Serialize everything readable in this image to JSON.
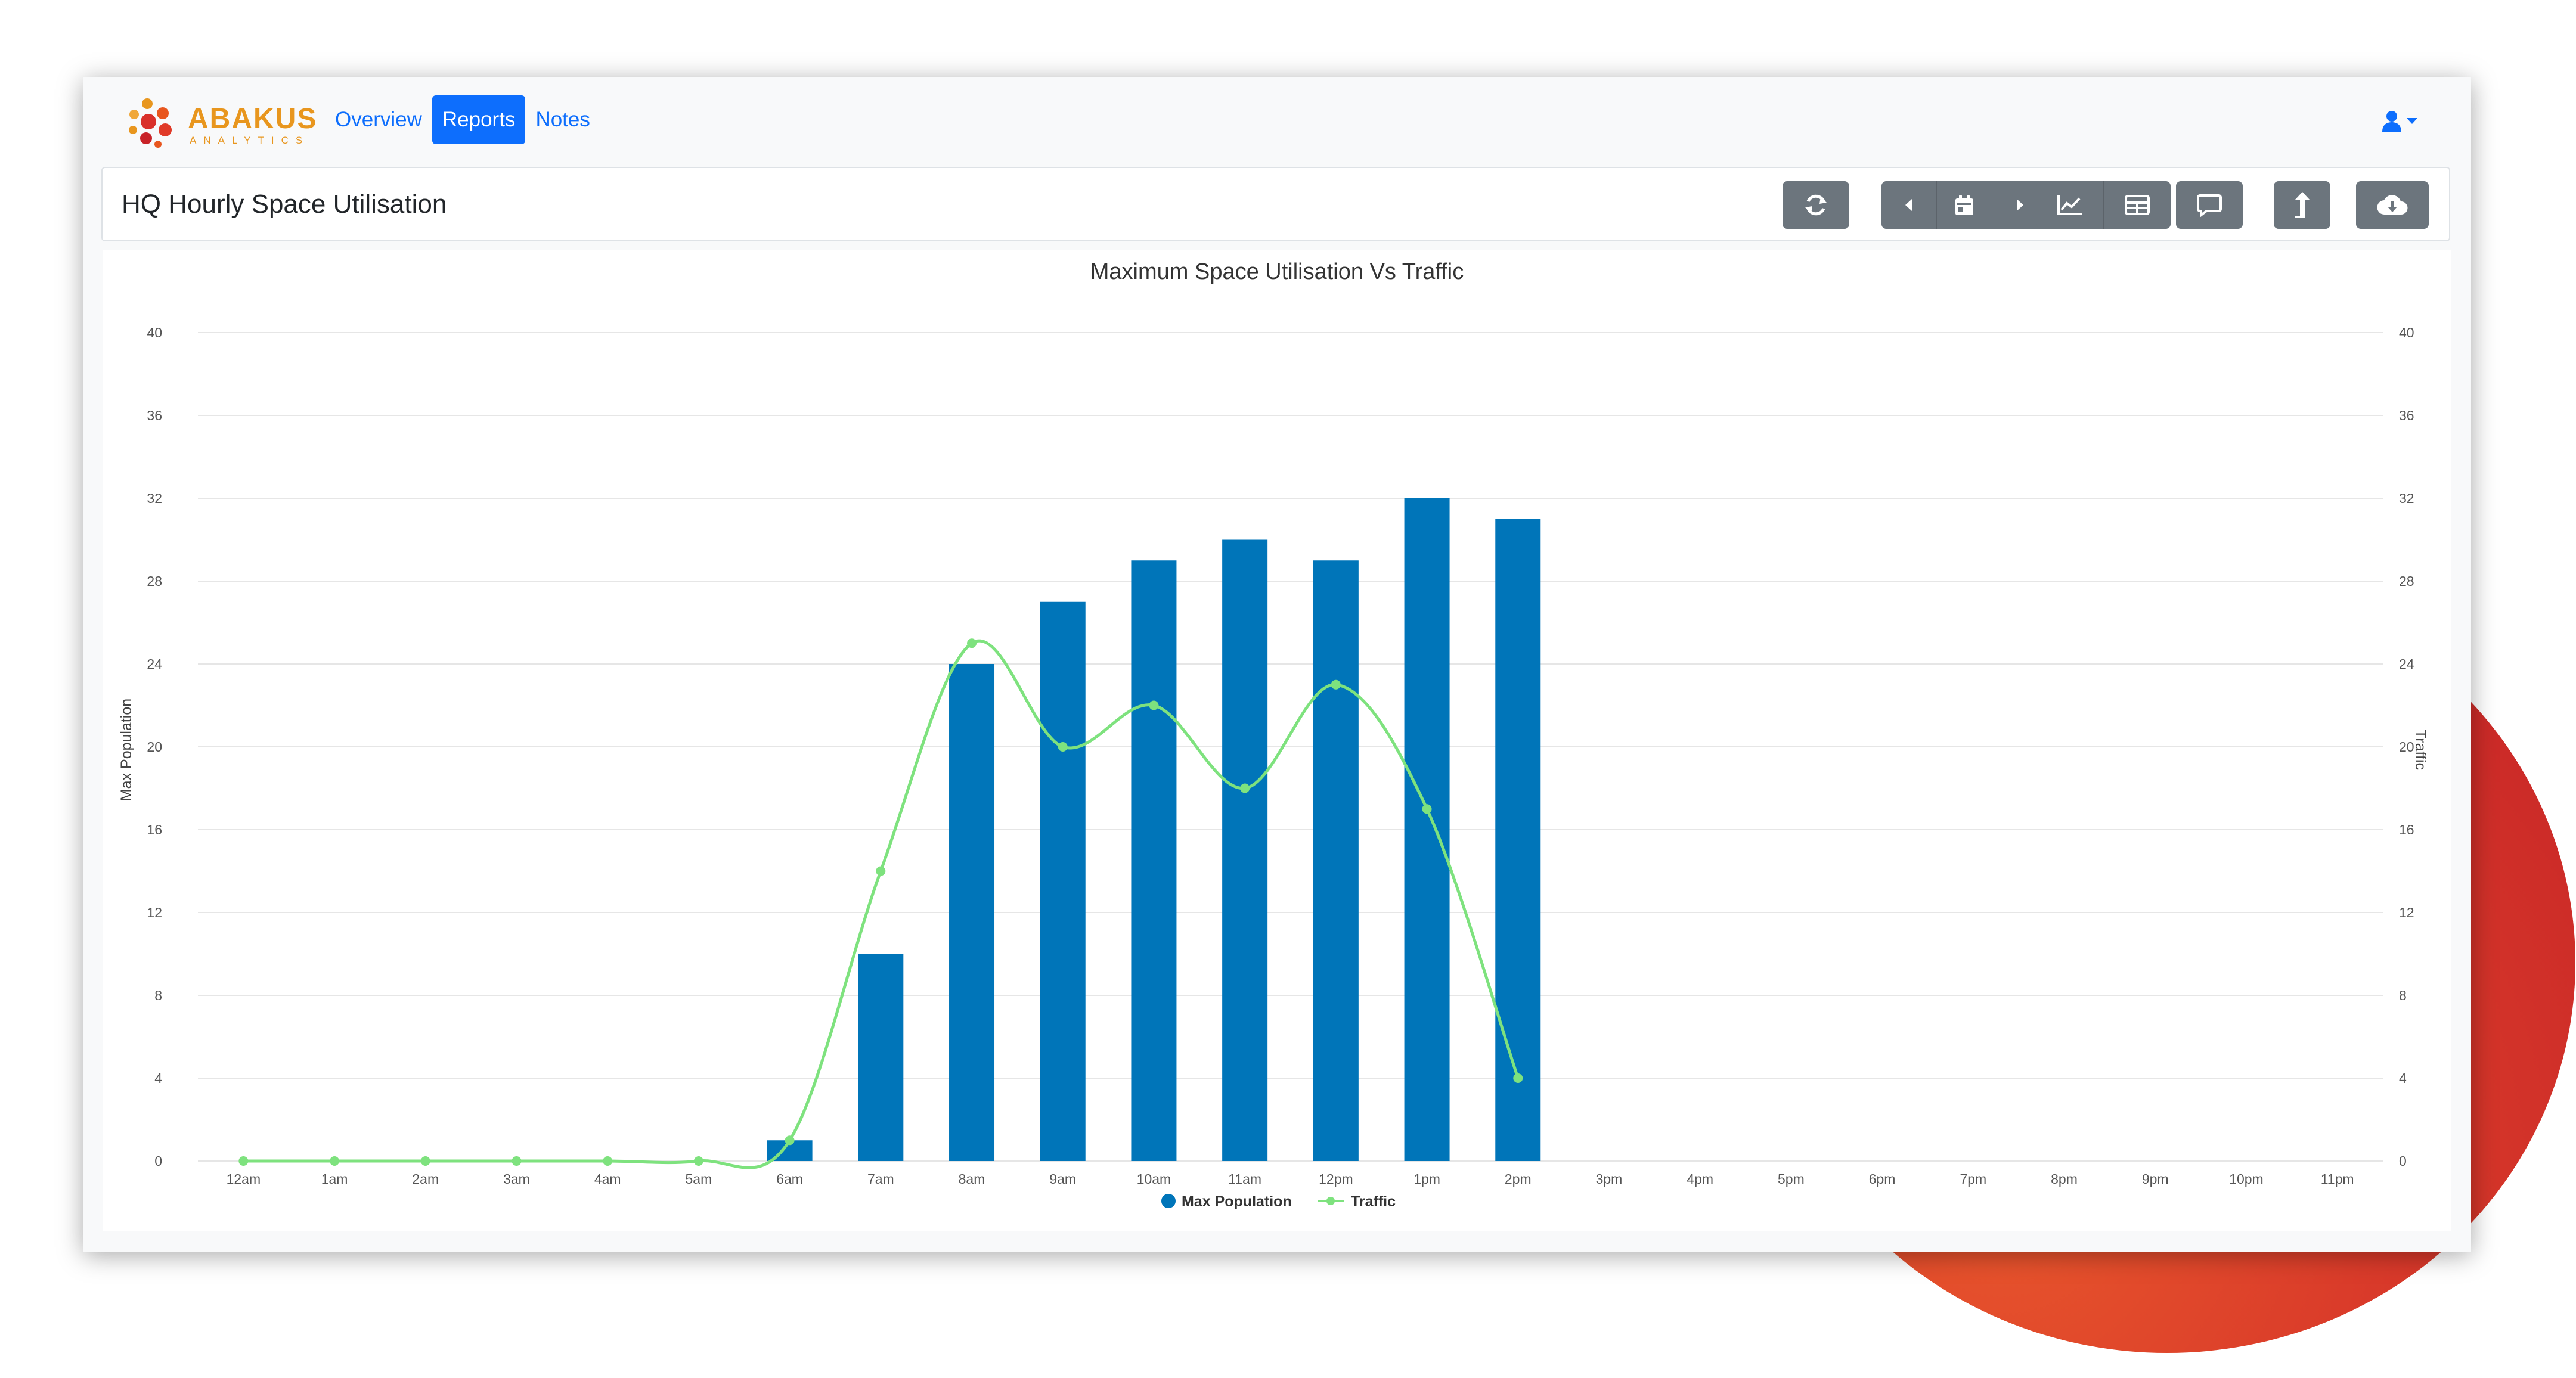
{
  "app": {
    "logo_text": "ABAKUS",
    "logo_subtext": "ANALYTICS"
  },
  "nav": {
    "links": [
      {
        "label": "Overview",
        "active": false
      },
      {
        "label": "Reports",
        "active": true
      },
      {
        "label": "Notes",
        "active": false
      }
    ],
    "user_icon": "user-icon"
  },
  "report": {
    "title": "HQ Hourly Space Utilisation",
    "toolbar": [
      {
        "name": "refresh-button",
        "icon": "refresh-icon"
      },
      {
        "name": "previous-button",
        "icon": "caret-left-icon"
      },
      {
        "name": "calendar-button",
        "icon": "calendar-icon"
      },
      {
        "name": "next-button",
        "icon": "caret-right-icon"
      },
      {
        "name": "chart-view-button",
        "icon": "line-chart-icon"
      },
      {
        "name": "table-view-button",
        "icon": "table-icon"
      },
      {
        "name": "comment-button",
        "icon": "comment-icon"
      },
      {
        "name": "share-button",
        "icon": "share-arrow-icon"
      },
      {
        "name": "download-button",
        "icon": "cloud-download-icon"
      }
    ]
  },
  "colors": {
    "bar": "#0075b9",
    "line": "#7ee27e",
    "primary": "#0d6efd",
    "button": "#6c757d",
    "grid": "#e6e6e6"
  },
  "chart_data": {
    "type": "bar",
    "title": "Maximum Space Utilisation Vs Traffic",
    "ylabel": "Max Population",
    "y2label": "Traffic",
    "ylim": [
      0,
      40
    ],
    "y2lim": [
      0,
      40
    ],
    "yticks": [
      0,
      4,
      8,
      12,
      16,
      20,
      24,
      28,
      32,
      36,
      40
    ],
    "grid": true,
    "legend_position": "bottom",
    "categories": [
      "12am",
      "1am",
      "2am",
      "3am",
      "4am",
      "5am",
      "6am",
      "7am",
      "8am",
      "9am",
      "10am",
      "11am",
      "12pm",
      "1pm",
      "2pm",
      "3pm",
      "4pm",
      "5pm",
      "6pm",
      "7pm",
      "8pm",
      "9pm",
      "10pm",
      "11pm"
    ],
    "series": [
      {
        "name": "Max Population",
        "type": "bar",
        "axis": "left",
        "values": [
          0,
          0,
          0,
          0,
          0,
          0,
          1,
          10,
          24,
          27,
          29,
          30,
          29,
          32,
          31,
          null,
          null,
          null,
          null,
          null,
          null,
          null,
          null,
          null
        ]
      },
      {
        "name": "Traffic",
        "type": "line",
        "axis": "right",
        "values": [
          0,
          0,
          0,
          0,
          0,
          0,
          1,
          14,
          25,
          20,
          22,
          18,
          23,
          17,
          4,
          null,
          null,
          null,
          null,
          null,
          null,
          null,
          null,
          null
        ]
      }
    ]
  }
}
